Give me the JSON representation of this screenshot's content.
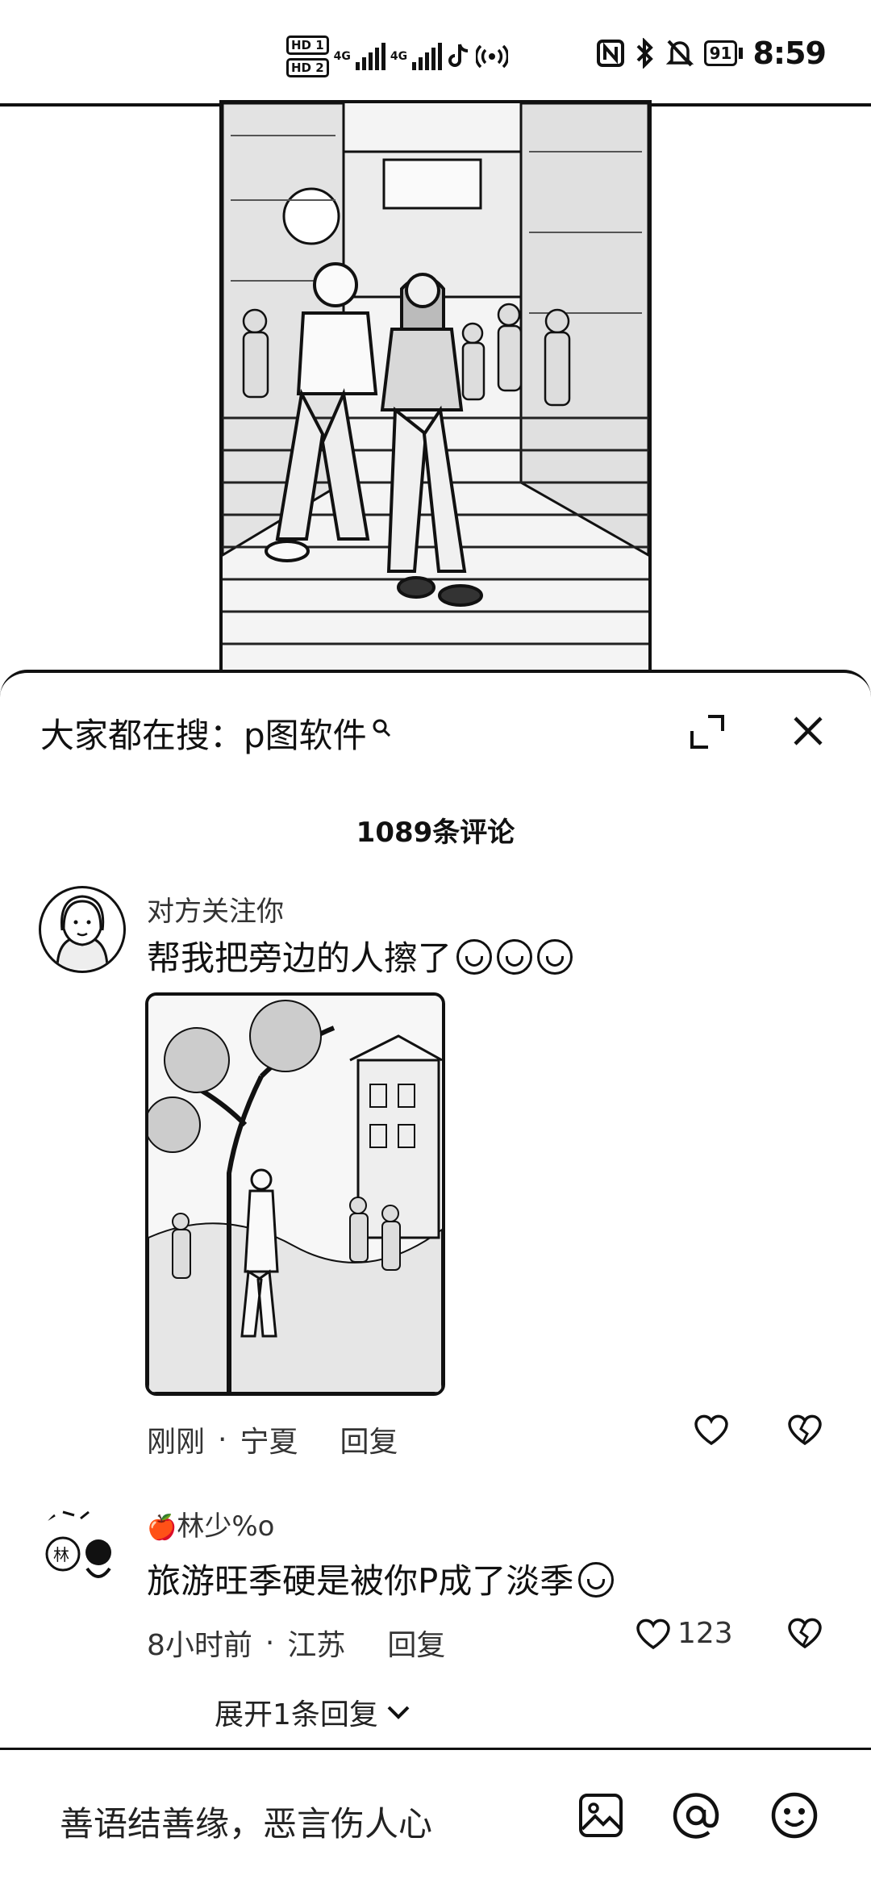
{
  "status_bar": {
    "hd1": "HD 1",
    "hd2": "HD 2",
    "net1": "4G",
    "net2": "4G",
    "battery": "91",
    "time": "8:59"
  },
  "sheet": {
    "search_text": "大家都在搜：p图软件",
    "comment_count": "1089条评论"
  },
  "comments": [
    {
      "user": "对方关注你",
      "text": "帮我把旁边的人擦了",
      "time": "刚刚",
      "location": "宁夏",
      "reply_label": "回复",
      "likes": ""
    },
    {
      "user": "林少%o",
      "text": "旅游旺季硬是被你P成了淡季",
      "time": "8小时前",
      "location": "江苏",
      "reply_label": "回复",
      "likes": "123",
      "expand_replies": "展开1条回复"
    }
  ],
  "bottom": {
    "input_placeholder": "善语结善缘，恶言伤人心"
  },
  "icons": [
    "search-icon",
    "expand-icon",
    "close-icon",
    "heart-icon",
    "broken-heart-icon",
    "chevron-down-icon",
    "image-icon",
    "at-icon",
    "emoji-icon"
  ]
}
